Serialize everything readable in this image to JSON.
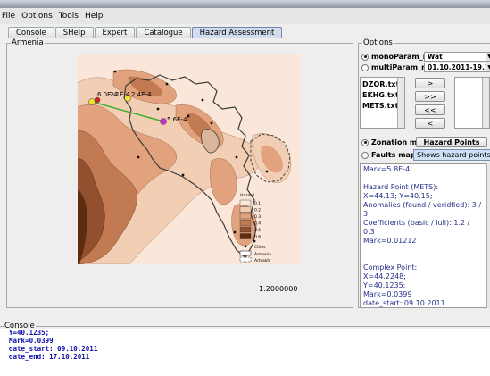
{
  "menu": [
    "File",
    "Options",
    "Tools",
    "Help"
  ],
  "tabs": [
    {
      "label": "Console",
      "active": false
    },
    {
      "label": "SHelp",
      "active": false
    },
    {
      "label": "Expert",
      "active": false
    },
    {
      "label": "Catalogue",
      "active": false
    },
    {
      "label": "Hazard Assessment",
      "active": true
    }
  ],
  "left_panel": {
    "title": "Armenia",
    "scale": "1:2000000",
    "point_labels": [
      "6.0E-4",
      "2.1E-4",
      "2.4E-4",
      "5.6E-4"
    ],
    "legend": {
      "title": "Hazard",
      "levels": [
        "0.1",
        "0.2",
        "0.3",
        "0.4",
        "0.5",
        "0.6"
      ],
      "colors": [
        "#fbe7d9",
        "#f2cfb4",
        "#e2a27e",
        "#c17a52",
        "#93502f",
        "#5e2c11"
      ],
      "symbols": [
        "Cities",
        "Armenia",
        "Artsakh"
      ]
    },
    "map_colors": {
      "background": "#fbe7d9",
      "border": "#3b3b3b",
      "line": "#3fae2e",
      "marker_yellow": "#f6e02c",
      "marker_red": "#d81f1f",
      "marker_magenta": "#d12ad1"
    }
  },
  "options": {
    "title": "Options",
    "mono_label": "monoParam_mode",
    "mono_value": "Wat",
    "multi_label": "multiParam_mode",
    "multi_value": "01.10.2011-19.10.2011",
    "files": [
      "DZOR.txt",
      "EKHG.txt",
      "METS.txt"
    ],
    "buttons": [
      ">",
      ">>",
      "<<",
      "<"
    ],
    "zonation_label": "Zonation map",
    "faults_label": "Faults map",
    "hazard_points_label": "Hazard Points",
    "tooltip": "Shows hazard points on the"
  },
  "text_output": {
    "lines": [
      "Mark=5.8E-4",
      "",
      "Hazard Point (METS):",
      "X=44.13; Y=40.15;",
      "Anomalies (found / veridfied): 3 / 3",
      "Coefficients (basic / lull): 1.2 / 0.3",
      "Mark=0.01212",
      "",
      "",
      "Complex Point:",
      "X=44.2248;",
      "Y=40.1235;",
      "Mark=0.0399",
      "date_start: 09.10.2011",
      "date_end: 17.10.2011"
    ]
  },
  "console": {
    "title": "Console",
    "lines": [
      "Y=40.1235;",
      "Mark=0.0399",
      "date_start: 09.10.2011",
      "date_end: 17.10.2011"
    ]
  }
}
